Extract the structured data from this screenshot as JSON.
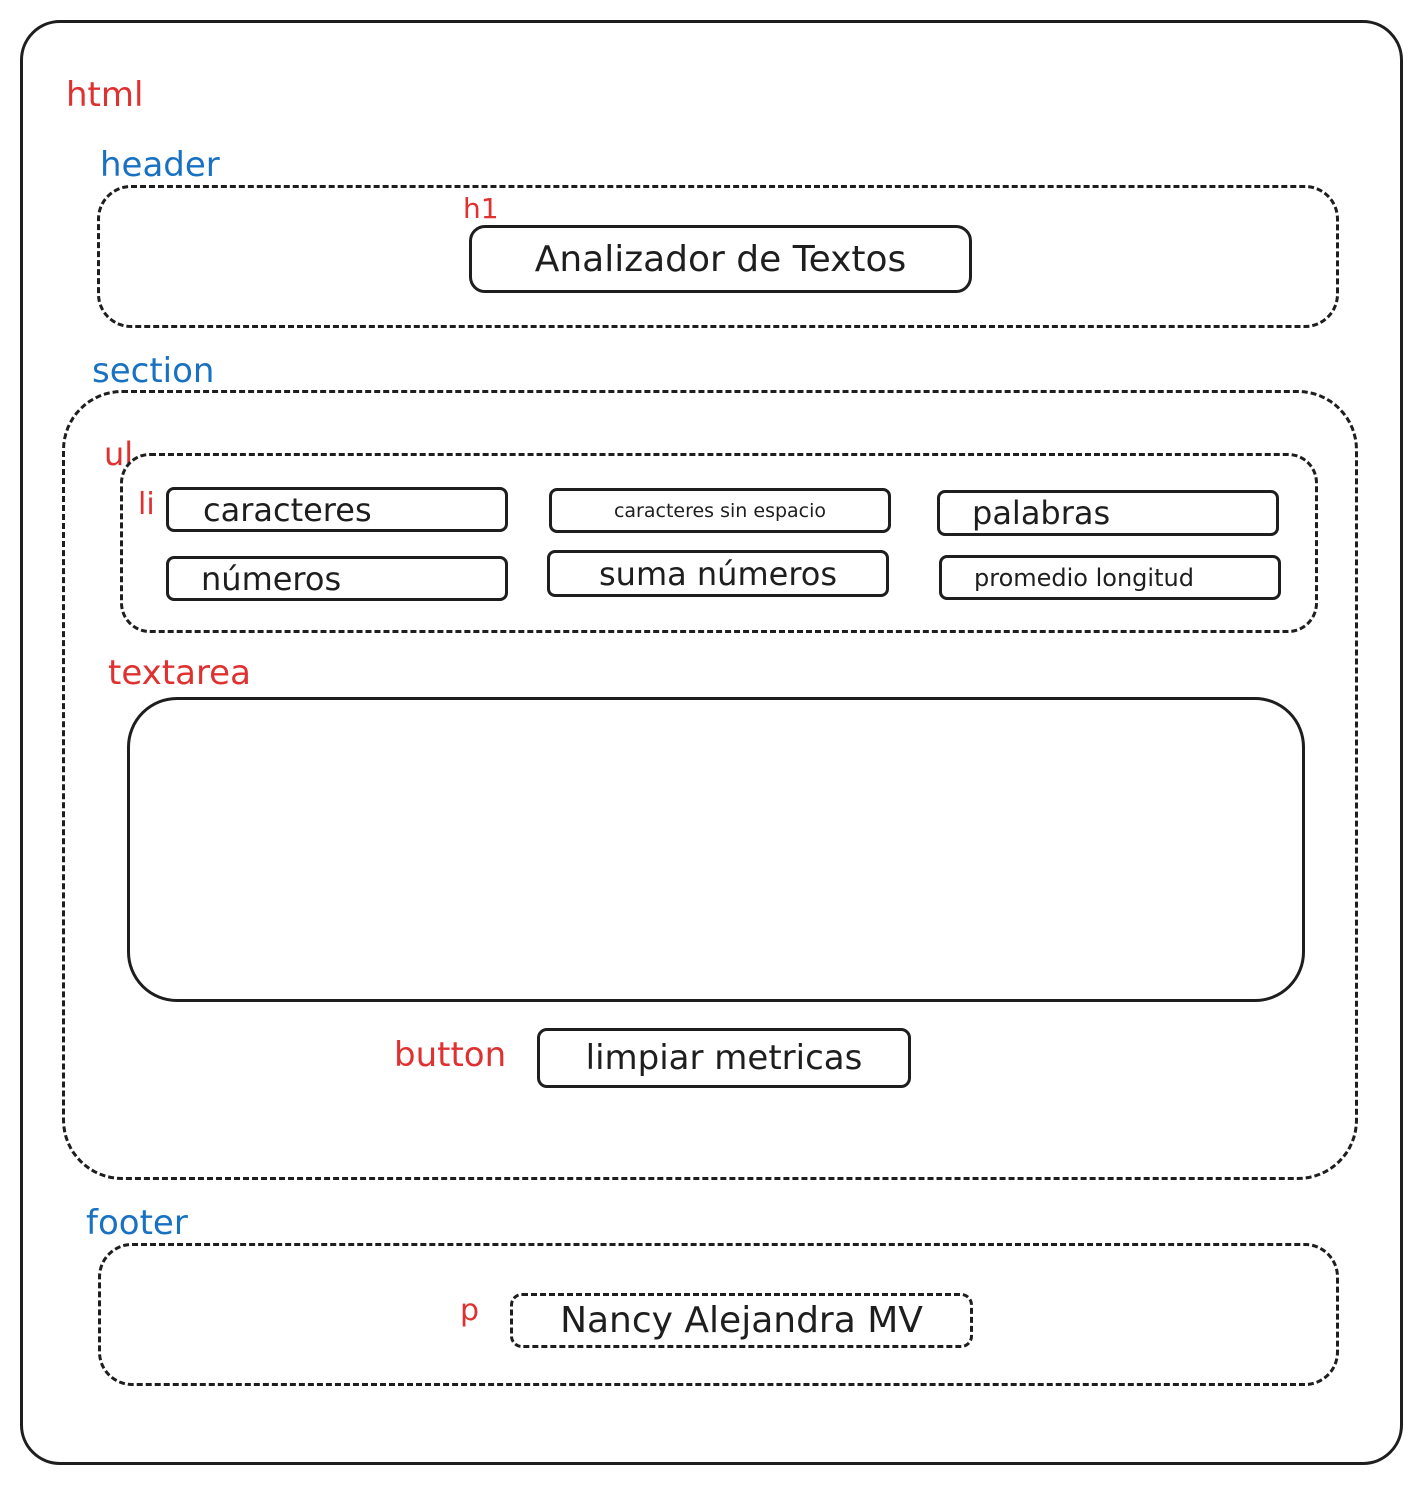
{
  "labels": {
    "html": "html",
    "header": "header",
    "h1": "h1",
    "section": "section",
    "ul": "ul",
    "li": "li",
    "textarea": "textarea",
    "button": "button",
    "footer": "footer",
    "p": "p"
  },
  "header": {
    "title": "Analizador de Textos"
  },
  "metrics": [
    "caracteres",
    "caracteres sin espacio",
    "palabras",
    "números",
    "suma números",
    "promedio longitud"
  ],
  "button": {
    "label": "limpiar metricas"
  },
  "footer": {
    "author": "Nancy Alejandra MV"
  },
  "colors": {
    "element_label_red": "#e03131",
    "element_label_blue": "#1971c2",
    "stroke": "#1e1e1e"
  }
}
